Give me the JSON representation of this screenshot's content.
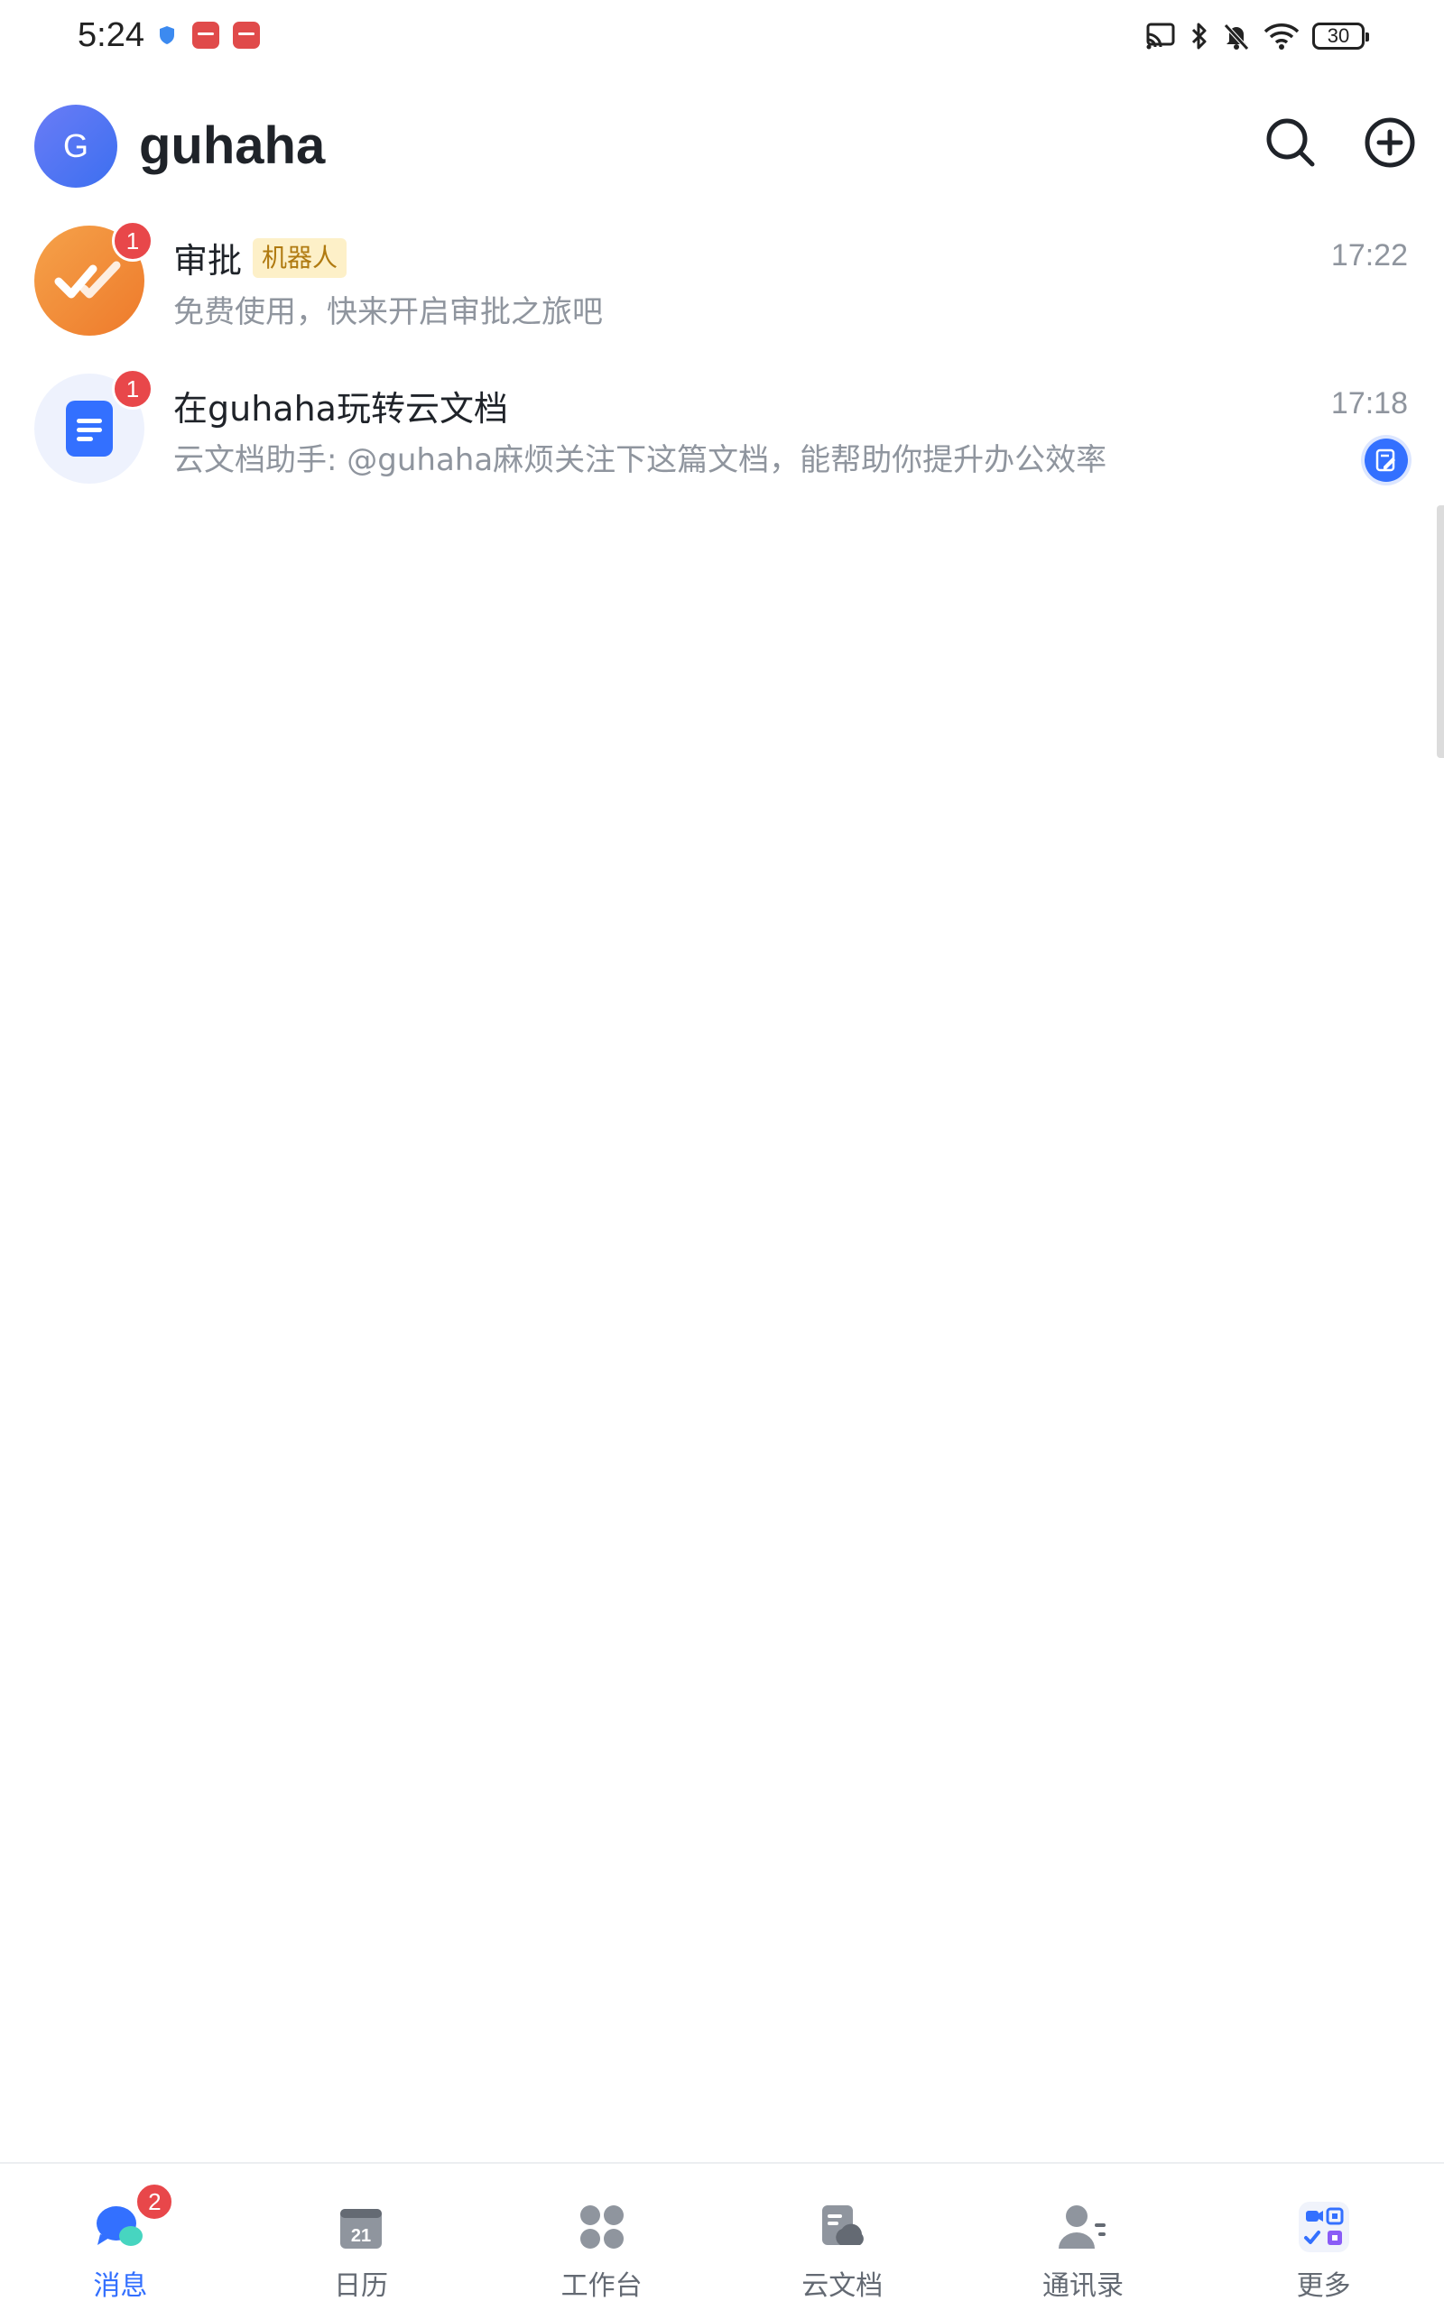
{
  "status_bar": {
    "time": "5:24",
    "battery": "30"
  },
  "header": {
    "avatar_letter": "G",
    "username": "guhaha"
  },
  "chats": [
    {
      "title": "审批",
      "tag": "机器人",
      "preview": "免费使用，快来开启审批之旅吧",
      "time": "17:22",
      "unread": "1"
    },
    {
      "title": "在guhaha玩转云文档",
      "preview": "云文档助手: @guhaha麻烦关注下这篇文档，能帮助你提升办公效率",
      "time": "17:18",
      "unread": "1"
    }
  ],
  "bottom_nav": {
    "items": [
      {
        "label": "消息",
        "badge": "2",
        "active": true
      },
      {
        "label": "日历",
        "calendar_day": "21"
      },
      {
        "label": "工作台"
      },
      {
        "label": "云文档"
      },
      {
        "label": "通讯录"
      },
      {
        "label": "更多"
      }
    ]
  },
  "colors": {
    "accent": "#3370ff",
    "badge": "#e8474a",
    "approval_orange": "#ee7a2b",
    "tag_bg": "#fdf0c8",
    "tag_text": "#b07a10",
    "muted_text": "#8f959e"
  }
}
